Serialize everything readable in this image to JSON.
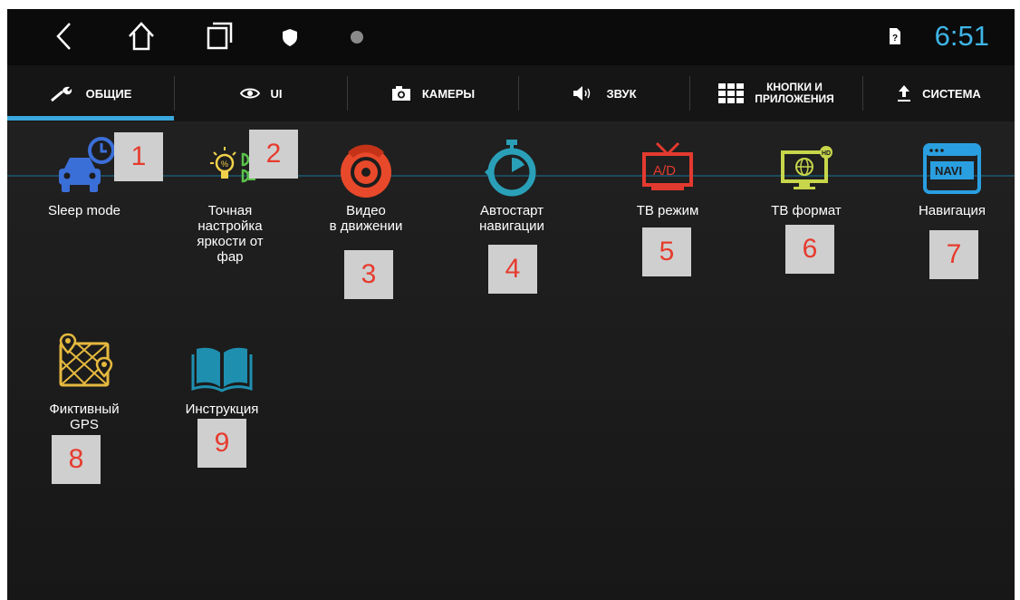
{
  "status_bar": {
    "icons": [
      "back-icon",
      "home-icon",
      "recents-icon",
      "shield-icon",
      "circle-icon"
    ],
    "sim_icon": "sim-card-icon",
    "time": "6:51",
    "accent": "#3fb5e6"
  },
  "tabs": [
    {
      "label": "ОБЩИЕ",
      "icon": "wrench-icon",
      "active": true
    },
    {
      "label": "UI",
      "icon": "eye-icon"
    },
    {
      "label": "КАМЕРЫ",
      "icon": "camera-icon"
    },
    {
      "label": "ЗВУК",
      "icon": "speaker-icon"
    },
    {
      "label_line1": "КНОПКИ И",
      "label_line2": "ПРИЛОЖЕНИЯ",
      "icon": "grid-icon"
    },
    {
      "label": "СИСТЕМА",
      "icon": "upload-icon"
    }
  ],
  "apps": [
    {
      "label": "Sleep mode",
      "icon": "car-clock-icon",
      "badge": "1"
    },
    {
      "label": "Точная\nнастройка\nяркости от\nфар",
      "icon": "headlight-bulb-icon",
      "badge": "2"
    },
    {
      "label": "Видео\nв движении",
      "icon": "brake-disc-icon",
      "badge": "3"
    },
    {
      "label": "Автостарт\nнавигации",
      "icon": "stopwatch-icon",
      "badge": "4"
    },
    {
      "label": "ТВ режим",
      "icon": "tv-ad-icon",
      "badge": "5"
    },
    {
      "label": "ТВ формат",
      "icon": "tv-hd-icon",
      "badge": "6"
    },
    {
      "label": "Навигация",
      "icon": "navi-icon",
      "badge": "7"
    },
    {
      "label": "Фиктивный\nGPS",
      "icon": "map-pin-icon",
      "badge": "8"
    },
    {
      "label": "Инструкция",
      "icon": "book-icon",
      "badge": "9"
    }
  ]
}
